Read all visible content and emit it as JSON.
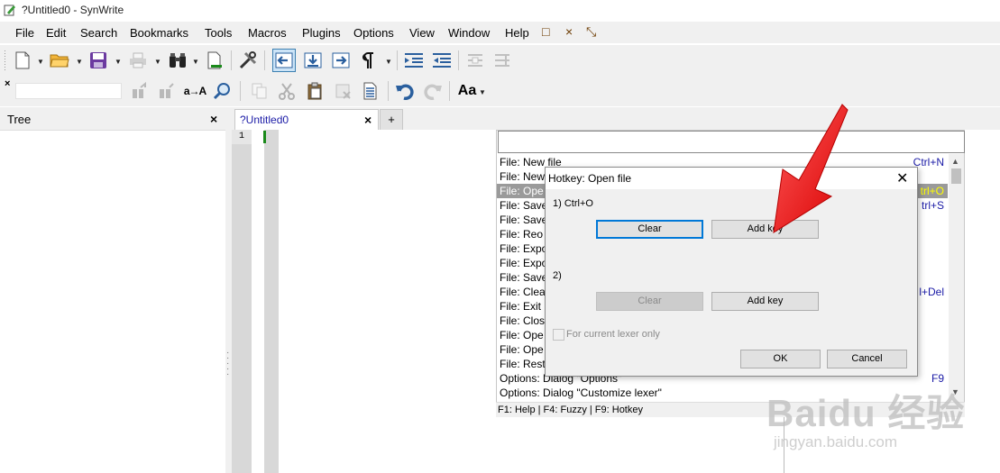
{
  "window": {
    "title": "?Untitled0 - SynWrite"
  },
  "menubar": {
    "items": [
      "File",
      "Edit",
      "Search",
      "Bookmarks",
      "Tools",
      "Macros",
      "Plugins",
      "Options",
      "View",
      "Window",
      "Help"
    ],
    "extra_glyphs": [
      "□",
      "×",
      "⤡"
    ]
  },
  "toolbar2": {
    "replace_label": "a→A",
    "font_label": "Aa"
  },
  "tree_panel": {
    "title": "Tree",
    "close": "×"
  },
  "tabs": {
    "active_label": "?Untitled0",
    "close": "×",
    "add": "+"
  },
  "editor": {
    "line_number": "1"
  },
  "command_list": {
    "rows": [
      {
        "name": "File: New file",
        "key": "Ctrl+N"
      },
      {
        "name": "File: New",
        "key": ""
      },
      {
        "name": "File: Ope",
        "key": "trl+O",
        "selected": true
      },
      {
        "name": "File: Save",
        "key": "trl+S"
      },
      {
        "name": "File: Save",
        "key": ""
      },
      {
        "name": "File: Reo",
        "key": ""
      },
      {
        "name": "File: Expo",
        "key": ""
      },
      {
        "name": "File: Expo",
        "key": ""
      },
      {
        "name": "File: Save",
        "key": ""
      },
      {
        "name": "File: Clea",
        "key": "l+Del"
      },
      {
        "name": "File: Exit",
        "key": ""
      },
      {
        "name": "File: Clos",
        "key": ""
      },
      {
        "name": "File: Ope",
        "key": ""
      },
      {
        "name": "File: Ope",
        "key": ""
      },
      {
        "name": "File: Rest",
        "key": ""
      },
      {
        "name": "Options: Dialog \"Options\"",
        "key": "F9"
      },
      {
        "name": "Options: Dialog \"Customize lexer\"",
        "key": ""
      }
    ],
    "status": "F1: Help | F4: Fuzzy | F9: Hotkey"
  },
  "dialog": {
    "title": "Hotkey: Open file",
    "close": "✕",
    "slot1_label": "1)  Ctrl+O",
    "slot2_label": "2)",
    "clear_label": "Clear",
    "add_key_label": "Add key",
    "checkbox_label": "For current lexer only",
    "ok_label": "OK",
    "cancel_label": "Cancel"
  },
  "watermark": {
    "brand": "Baidu 经验",
    "url": "jingyan.baidu.com"
  },
  "colors": {
    "selection_bg": "#9a9a9a",
    "selection_key": "#ffff00",
    "arrow": "#ff1a1a",
    "accent": "#0078d7"
  }
}
